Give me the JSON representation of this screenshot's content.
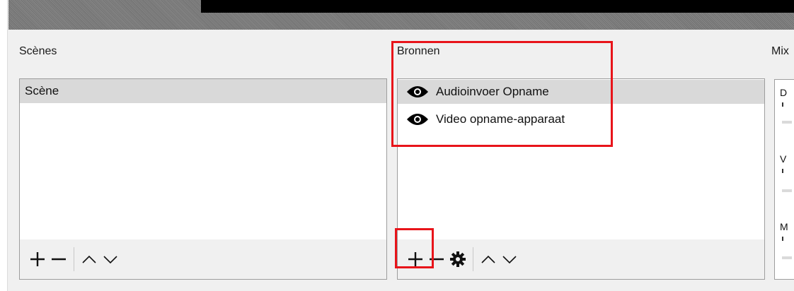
{
  "scenes_dock": {
    "title": "Scènes",
    "items": [
      {
        "label": "Scène",
        "selected": true
      }
    ]
  },
  "sources_dock": {
    "title": "Bronnen",
    "items": [
      {
        "label": "Audioinvoer Opname",
        "icon": "eye-icon",
        "selected": true
      },
      {
        "label": "Video opname-apparaat",
        "icon": "eye-icon",
        "selected": false
      }
    ]
  },
  "mixer_dock": {
    "title": "Mix",
    "channel_initials": [
      "D",
      "V",
      "M"
    ]
  },
  "toolbar_icons": {
    "scenes": [
      "add-icon",
      "remove-icon",
      "move-up-icon",
      "move-down-icon"
    ],
    "sources": [
      "add-icon",
      "remove-icon",
      "gear-icon",
      "move-up-icon",
      "move-down-icon"
    ]
  },
  "colors": {
    "highlight": "#e8141a",
    "selection": "#d9d9d9",
    "background": "#f0f0f0"
  }
}
